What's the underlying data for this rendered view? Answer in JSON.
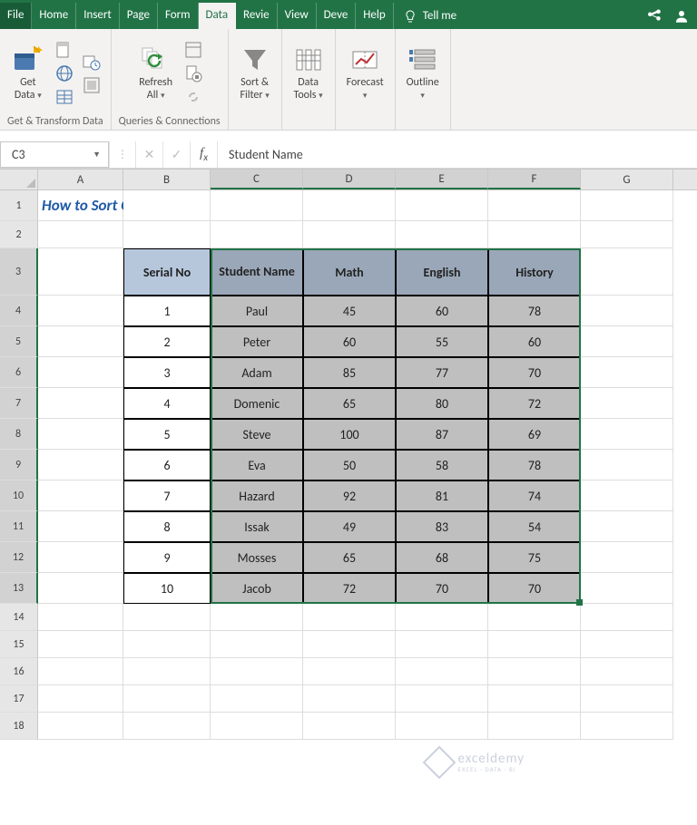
{
  "ribbon_tabs": {
    "file": "File",
    "items": [
      "Home",
      "Insert",
      "Page",
      "Form",
      "Data",
      "Revie",
      "View",
      "Deve",
      "Help"
    ],
    "active_index": 4,
    "tellme": "Tell me"
  },
  "ribbon_groups": {
    "get_transform": {
      "label": "Get & Transform Data",
      "get_data": "Get\nData"
    },
    "queries": {
      "label": "Queries & Connections",
      "refresh_all": "Refresh\nAll"
    },
    "sort_filter": {
      "label": "Sort &\nFilter"
    },
    "data_tools": {
      "label": "Data\nTools"
    },
    "forecast": {
      "label": "Forecast"
    },
    "outline": {
      "label": "Outline"
    }
  },
  "name_box": "C3",
  "formula_bar_value": "Student Name",
  "columns": [
    "A",
    "B",
    "C",
    "D",
    "E",
    "F",
    "G"
  ],
  "title": "How to Sort Columns in Excel without Mixing Data",
  "table": {
    "headers": [
      "Serial No",
      "Student Name",
      "Math",
      "English",
      "History"
    ],
    "rows": [
      {
        "serial": "1",
        "name": "Paul",
        "math": "45",
        "english": "60",
        "history": "78"
      },
      {
        "serial": "2",
        "name": "Peter",
        "math": "60",
        "english": "55",
        "history": "60"
      },
      {
        "serial": "3",
        "name": "Adam",
        "math": "85",
        "english": "77",
        "history": "70"
      },
      {
        "serial": "4",
        "name": "Domenic",
        "math": "65",
        "english": "80",
        "history": "72"
      },
      {
        "serial": "5",
        "name": "Steve",
        "math": "100",
        "english": "87",
        "history": "69"
      },
      {
        "serial": "6",
        "name": "Eva",
        "math": "50",
        "english": "58",
        "history": "78"
      },
      {
        "serial": "7",
        "name": "Hazard",
        "math": "92",
        "english": "81",
        "history": "74"
      },
      {
        "serial": "8",
        "name": "Issak",
        "math": "49",
        "english": "83",
        "history": "54"
      },
      {
        "serial": "9",
        "name": "Mosses",
        "math": "65",
        "english": "68",
        "history": "75"
      },
      {
        "serial": "10",
        "name": "Jacob",
        "math": "72",
        "english": "70",
        "history": "70"
      }
    ]
  },
  "watermark": {
    "brand": "exceldemy",
    "tagline": "EXCEL · DATA · BI"
  },
  "colors": {
    "excel_green": "#217346",
    "header_blue": "#b6c7dc",
    "header_grey": "#9aa7b8",
    "sel_grey": "#bfbfbf"
  }
}
